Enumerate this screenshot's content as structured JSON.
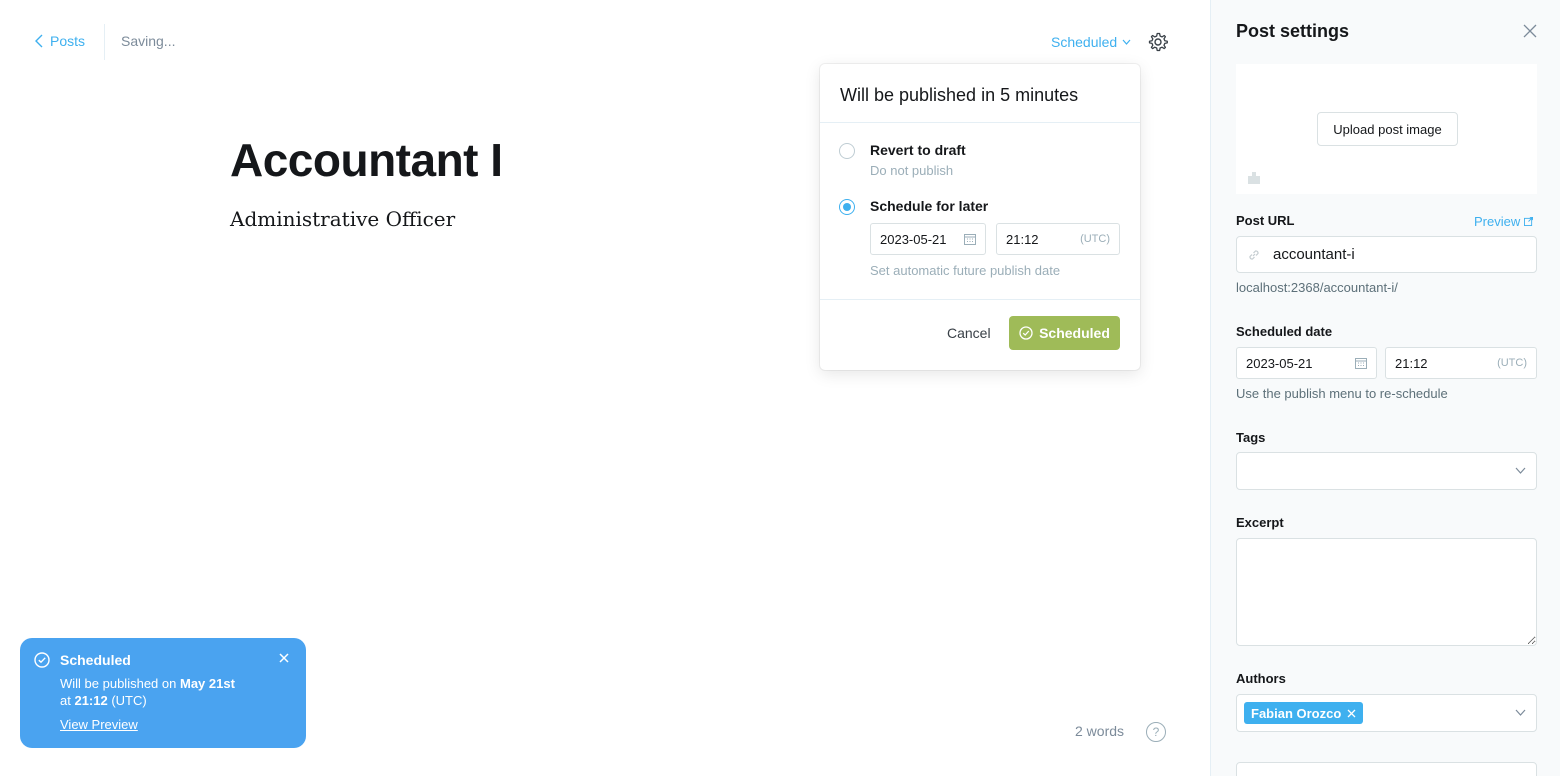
{
  "header": {
    "back_label": "Posts",
    "saving_status": "Saving...",
    "status_dropdown": "Scheduled"
  },
  "post": {
    "title": "Accountant I",
    "subtitle": "Administrative Officer"
  },
  "footer": {
    "word_count": "2 words",
    "help": "?"
  },
  "publish_menu": {
    "heading": "Will be published in 5 minutes",
    "options": [
      {
        "label": "Revert to draft",
        "description": "Do not publish",
        "selected": false
      },
      {
        "label": "Schedule for later",
        "description": "Set automatic future publish date",
        "selected": true
      }
    ],
    "date": "2023-05-21",
    "time": "21:12",
    "timezone": "(UTC)",
    "cancel_label": "Cancel",
    "confirm_label": "Scheduled",
    "confirm_color": "#9fbb58"
  },
  "toast": {
    "title": "Scheduled",
    "msg_prefix": "Will be published on",
    "msg_date": "May 21st",
    "msg_at": "at",
    "msg_time": "21:12",
    "msg_tz": "(UTC)",
    "link": "View Preview",
    "color": "#4aa3f0"
  },
  "settings_panel": {
    "title": "Post settings",
    "upload_label": "Upload post image",
    "post_url_label": "Post URL",
    "preview_label": "Preview",
    "slug": "accountant-i",
    "full_url": "localhost:2368/accountant-i/",
    "scheduled_date_label": "Scheduled date",
    "date": "2023-05-21",
    "time": "21:12",
    "timezone": "(UTC)",
    "reschedule_hint": "Use the publish menu to re-schedule",
    "tags_label": "Tags",
    "excerpt_label": "Excerpt",
    "authors_label": "Authors",
    "authors": [
      "Fabian Orozco"
    ]
  },
  "colors": {
    "accent": "#3eb0ef",
    "text": "#15171a",
    "muted": "#9baeb8"
  }
}
